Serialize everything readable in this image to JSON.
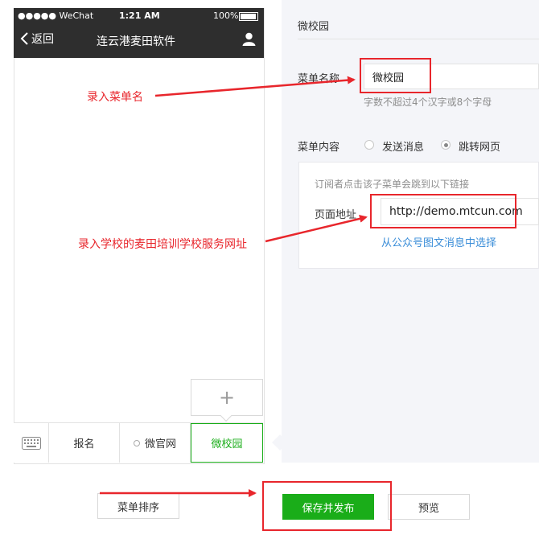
{
  "phone": {
    "status_carrier": "●●●●● WeChat",
    "status_time": "1:21 AM",
    "status_battery": "100%",
    "back_label": "返回",
    "title": "连云港麦田软件",
    "menu_items": [
      "报名",
      "微官网",
      "微校园"
    ],
    "add_symbol": "+"
  },
  "editor": {
    "section_title": "微校园",
    "menu_name_label": "菜单名称",
    "menu_name_value": "微校园",
    "menu_name_hint": "字数不超过4个汉字或8个字母",
    "menu_content_label": "菜单内容",
    "radio_send": "发送消息",
    "radio_jump": "跳转网页",
    "jump_desc": "订阅者点击该子菜单会跳到以下链接",
    "page_url_label": "页面地址",
    "page_url_value": "http://demo.mtcun.com",
    "choose_from_articles": "从公众号图文消息中选择"
  },
  "annotations": {
    "enter_menu_name": "录入菜单名",
    "enter_school_url": "录入学校的麦田培训学校服务网址"
  },
  "actions": {
    "sort": "菜单排序",
    "save_publish": "保存并发布",
    "preview": "预览"
  },
  "colors": {
    "accent_green": "#1aad19",
    "annotation_red": "#e8262c",
    "phone_header": "#2e2e2e"
  }
}
